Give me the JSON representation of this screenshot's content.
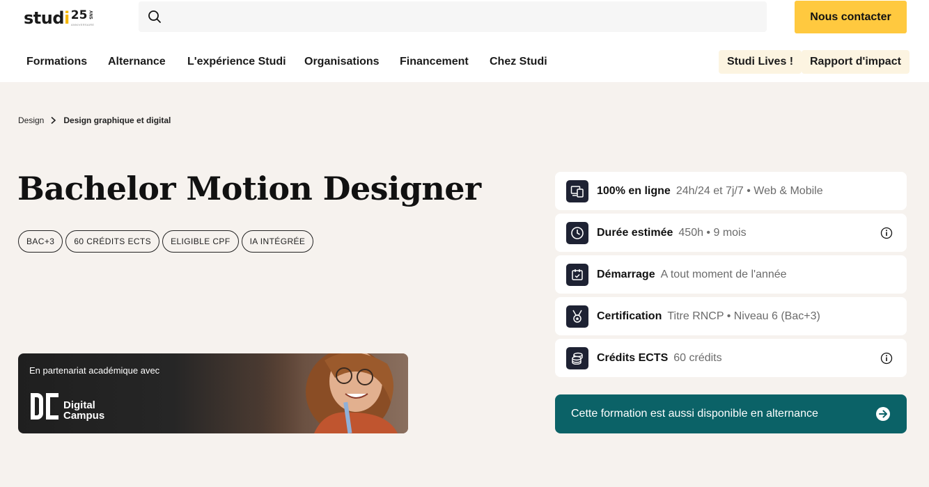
{
  "brand": {
    "logo_word_main": "stud",
    "logo_word_accent": "i",
    "logo_number": "25",
    "logo_suffix": "ANS",
    "logo_subtitle": "ANNIVERSAIRE",
    "accent_color": "#ffc93f",
    "dark_color": "#1e2233",
    "teal_color": "#0b6267"
  },
  "search": {
    "icon": "search-icon",
    "value": "",
    "placeholder": ""
  },
  "header": {
    "contact_label": "Nous contacter"
  },
  "nav": {
    "items": [
      {
        "label": "Formations"
      },
      {
        "label": "Alternance"
      },
      {
        "label": "L'expérience Studi"
      },
      {
        "label": "Organisations"
      },
      {
        "label": "Financement"
      },
      {
        "label": "Chez Studi"
      }
    ],
    "pills": [
      {
        "label": "Studi Lives !"
      },
      {
        "label": "Rapport d'impact"
      }
    ]
  },
  "breadcrumb": {
    "items": [
      {
        "label": "Design"
      },
      {
        "label": "Design graphique et digital"
      }
    ],
    "separator_icon": "chevron-right-icon"
  },
  "course": {
    "title": "Bachelor Motion Designer",
    "tags": [
      "BAC+3",
      "60 CRÉDITS ECTS",
      "ELIGIBLE CPF",
      "IA INTÉGRÉE"
    ]
  },
  "partner": {
    "intro": "En partenariat académique avec",
    "name_line1": "Digital",
    "name_line2": "Campus",
    "logo_icon": "digital-campus-logo-icon"
  },
  "info": [
    {
      "icon": "devices-icon",
      "label": "100% en ligne",
      "value": "24h/24 et 7j/7 • Web & Mobile",
      "has_info": false
    },
    {
      "icon": "clock-icon",
      "label": "Durée estimée",
      "value": "450h • 9 mois",
      "has_info": true
    },
    {
      "icon": "calendar-check-icon",
      "label": "Démarrage",
      "value": "A tout moment de l'année",
      "has_info": false
    },
    {
      "icon": "medal-icon",
      "label": "Certification",
      "value": "Titre RNCP • Niveau 6 (Bac+3)",
      "has_info": false
    },
    {
      "icon": "coins-icon",
      "label": "Crédits ECTS",
      "value": "60 crédits",
      "has_info": true
    }
  ],
  "alternance": {
    "label": "Cette formation est aussi disponible en alternance",
    "icon": "arrow-right-circle-icon"
  }
}
